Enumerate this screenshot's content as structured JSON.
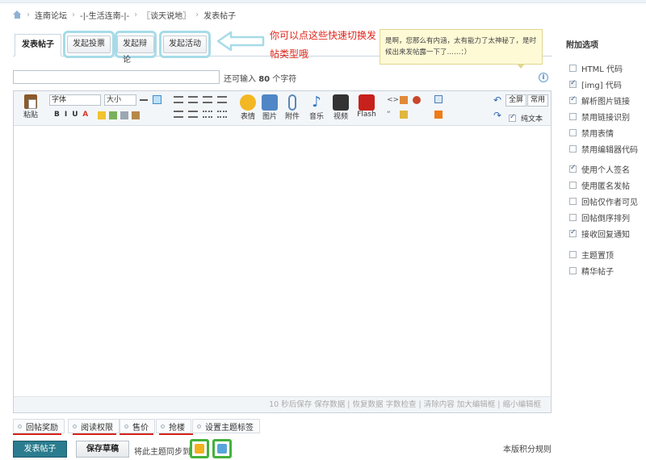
{
  "breadcrumb": [
    "连南论坛",
    "-|-生活连南-|-",
    "〖谈天说地〗",
    "发表帖子"
  ],
  "tabs": {
    "active": "发表帖子",
    "quick": [
      "发起投票",
      "发起辩论",
      "发起活动"
    ]
  },
  "annotation": "你可以点这些快速切换发帖类型哦",
  "tooltip": "是啊，您那么有内涵，太有能力了太神秘了，是时候出来发帖露一下了……：）",
  "info_label": "i",
  "title_input": {
    "value": "",
    "hint_prefix": "还可输入",
    "hint_count": "80",
    "hint_suffix": "个字符"
  },
  "toolbar": {
    "paste": "粘贴",
    "font": "字体",
    "size": "大小",
    "emoji": "表情",
    "image": "图片",
    "attach": "附件",
    "music": "音乐",
    "video": "视频",
    "flash": "Flash",
    "fullscreen": "全屏",
    "common": "常用",
    "plaintext": "纯文本"
  },
  "statusbar": "10 秒后保存  保存数据 | 恢复数据    字数检查 | 清除内容    加大编辑框 | 缩小编辑框",
  "sidebar": {
    "title": "附加选项",
    "group1": [
      {
        "label": "HTML 代码",
        "checked": false,
        "disabled": false
      },
      {
        "label": "[img] 代码",
        "checked": true,
        "disabled": true
      },
      {
        "label": "解析图片链接",
        "checked": true,
        "disabled": false
      },
      {
        "label": "禁用链接识别",
        "checked": false,
        "disabled": false
      },
      {
        "label": "禁用表情",
        "checked": false,
        "disabled": false
      },
      {
        "label": "禁用编辑器代码",
        "checked": false,
        "disabled": false
      }
    ],
    "group2": [
      {
        "label": "使用个人签名",
        "checked": true,
        "disabled": false
      },
      {
        "label": "使用匿名发帖",
        "checked": false,
        "disabled": false
      },
      {
        "label": "回帖仅作者可见",
        "checked": false,
        "disabled": false
      },
      {
        "label": "回帖倒序排列",
        "checked": false,
        "disabled": false
      },
      {
        "label": "接收回复通知",
        "checked": true,
        "disabled": false
      }
    ],
    "group3": [
      {
        "label": "主题置顶",
        "checked": false,
        "disabled": false
      },
      {
        "label": "精华帖子",
        "checked": false,
        "disabled": false
      }
    ]
  },
  "extras": [
    "回帖奖励",
    "阅读权限",
    "售价",
    "抢楼",
    "设置主题标签"
  ],
  "footer": {
    "submit": "发表帖子",
    "draft": "保存草稿",
    "sync_text": "将此主题同步到",
    "rules": "本版积分规则"
  },
  "colors": {
    "accent": "#2a7c8e",
    "annotation": "#e0261b",
    "highlight": "#a7dbe8",
    "green": "#44b13c"
  }
}
